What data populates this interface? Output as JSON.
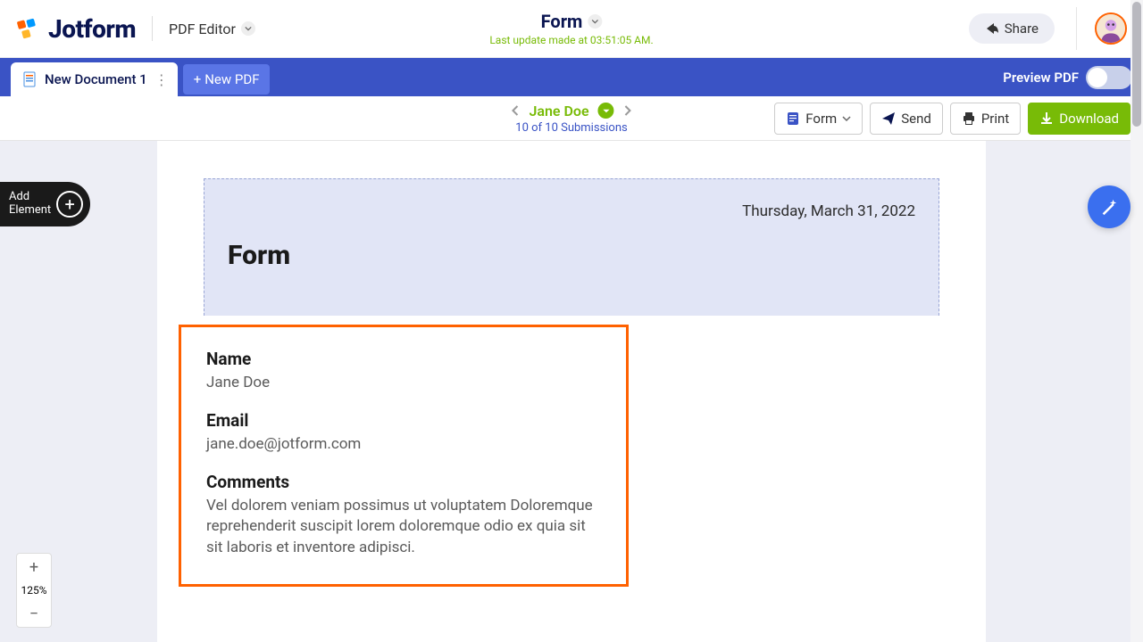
{
  "brand": {
    "name": "Jotform"
  },
  "header": {
    "editor_label": "PDF Editor",
    "form_title": "Form",
    "last_update": "Last update made at 03:51:05 AM.",
    "share_label": "Share"
  },
  "tabs": {
    "doc_label": "New Document 1",
    "new_pdf_label": "New PDF",
    "preview_label": "Preview PDF"
  },
  "toolbar": {
    "submitter": "Jane Doe",
    "sub_count": "10 of 10 Submissions",
    "form_label": "Form",
    "send_label": "Send",
    "print_label": "Print",
    "download_label": "Download"
  },
  "page": {
    "date": "Thursday, March 31, 2022",
    "title": "Form",
    "fields": {
      "name": {
        "label": "Name",
        "value": "Jane Doe"
      },
      "email": {
        "label": "Email",
        "value": "jane.doe@jotform.com"
      },
      "comments": {
        "label": "Comments",
        "value": "Vel dolorem veniam possimus ut voluptatem Doloremque reprehenderit suscipit lorem doloremque odio ex quia sit sit laboris et inventore adipisci."
      }
    }
  },
  "floating": {
    "add_line1": "Add",
    "add_line2": "Element"
  },
  "zoom": {
    "value": "125%"
  }
}
